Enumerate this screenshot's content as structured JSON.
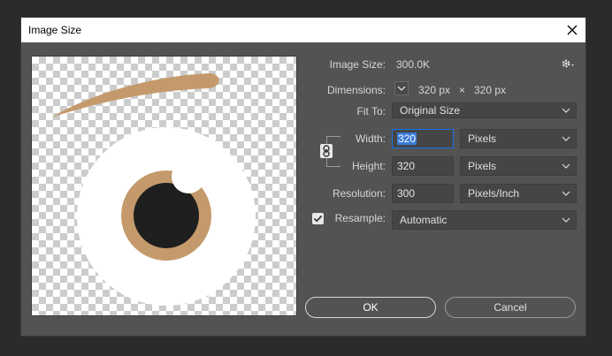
{
  "window": {
    "title": "Image Size"
  },
  "info": {
    "image_size_label": "Image Size:",
    "image_size_value": "300.0K",
    "dimensions_label": "Dimensions:",
    "dim_width": "320 px",
    "dim_times": "×",
    "dim_height": "320 px"
  },
  "fit_to": {
    "label": "Fit To:",
    "value": "Original Size"
  },
  "width": {
    "label": "Width:",
    "value": "320",
    "unit": "Pixels"
  },
  "height": {
    "label": "Height:",
    "value": "320",
    "unit": "Pixels"
  },
  "resolution": {
    "label": "Resolution:",
    "value": "300",
    "unit": "Pixels/Inch"
  },
  "resample": {
    "label": "Resample:",
    "checked": true,
    "value": "Automatic"
  },
  "buttons": {
    "ok": "OK",
    "cancel": "Cancel"
  },
  "colors": {
    "dialog_bg": "#535353",
    "eyebrow": "#c49a6c",
    "iris": "#c49a6c",
    "pupil": "#1f1f1f",
    "accent_focus": "#1473e6"
  }
}
